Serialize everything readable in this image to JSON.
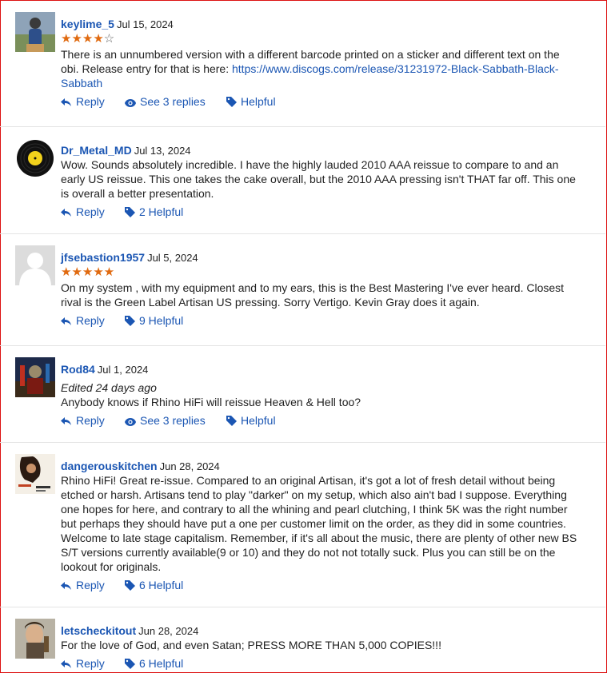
{
  "actions": {
    "reply": "Reply",
    "see_replies": "See 3 replies",
    "helpful": "Helpful"
  },
  "colors": {
    "link": "#1b56b3",
    "star": "#e06a10",
    "border": "#dd1111"
  },
  "reviews": [
    {
      "user": "keylime_5",
      "date": "Jul 15, 2024",
      "rating": 4,
      "text": "There is an unnumbered version with a different barcode printed on a sticker and different text on the obi. Release entry for that is here: ",
      "link": "https://www.discogs.com/release/31231972-Black-Sabbath-Black-Sabbath",
      "helpful": "Helpful",
      "replies": "See 3 replies",
      "avatar": "person-photo"
    },
    {
      "user": "Dr_Metal_MD",
      "date": "Jul 13, 2024",
      "text": "Wow. Sounds absolutely incredible. I have the highly lauded 2010 AAA reissue to compare to and an early US reissue. This one takes the cake overall, but the 2010 AAA pressing isn't THAT far off. This one is overall a better presentation.",
      "helpful": "2 Helpful",
      "avatar": "vinyl-record"
    },
    {
      "user": "jfsebastion1957",
      "date": "Jul 5, 2024",
      "rating": 5,
      "text": "On my system , with my equipment and to my ears, this is the Best Mastering I've ever heard. Closest rival is the Green Label Artisan US pressing. Sorry Vertigo. Kevin Gray does it again.",
      "helpful": "9 Helpful",
      "avatar": "default-avatar"
    },
    {
      "user": "Rod84",
      "date": "Jul 1, 2024",
      "edited": "Edited 24 days ago",
      "text": "Anybody knows if Rhino HiFi will reissue Heaven & Hell too?",
      "helpful": "Helpful",
      "replies": "See 3 replies",
      "avatar": "iron-maiden-art"
    },
    {
      "user": "dangerouskitchen",
      "date": "Jun 28, 2024",
      "text": "Rhino HiFi! Great re-issue. Compared to an original Artisan, it's got a lot of fresh detail without being etched or harsh. Artisans tend to play \"darker\" on my setup, which also ain't bad I suppose. Everything one hopes for here, and contrary to all the whining and pearl clutching, I think 5K was the right number but perhaps they should have put a one per customer limit on the order, as they did in some countries. Welcome to late stage capitalism. Remember, if it's all about the music, there are plenty of other new BS S/T versions currently available(9 or 10) and they do not not totally suck. Plus you can still be on the lookout for originals.",
      "helpful": "6 Helpful",
      "avatar": "zappa-album"
    },
    {
      "user": "letscheckitout",
      "date": "Jun 28, 2024",
      "text": "For the love of God, and even Satan; PRESS MORE THAN 5,000 COPIES!!!",
      "helpful": "6 Helpful",
      "avatar": "portrait-photo"
    }
  ]
}
